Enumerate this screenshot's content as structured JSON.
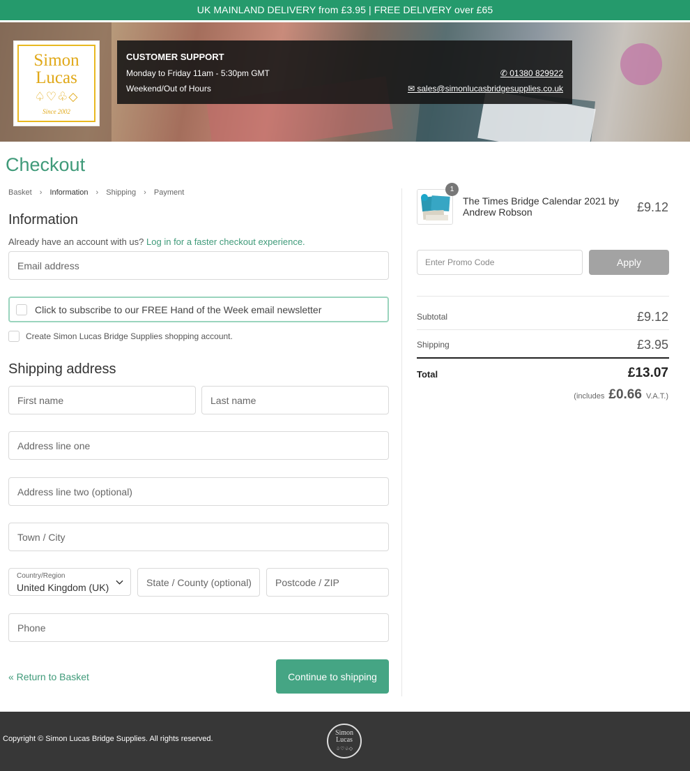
{
  "topbar": {
    "text": "UK MAINLAND DELIVERY from £3.95 | FREE DELIVERY over £65"
  },
  "logo": {
    "line1": "Simon",
    "line2": "Lucas",
    "suits": "♤♡♧◇",
    "since": "Since 2002"
  },
  "support": {
    "title": "CUSTOMER SUPPORT",
    "hours": "Monday to Friday 11am - 5:30pm GMT",
    "weekend": "Weekend/Out of Hours",
    "phone": "01380 829922",
    "email": "sales@simonlucasbridgesupplies.co.uk"
  },
  "page": {
    "title": "Checkout"
  },
  "breadcrumb": [
    "Basket",
    "Information",
    "Shipping",
    "Payment"
  ],
  "information": {
    "heading": "Information",
    "account_prompt": "Already have an account with us?",
    "login_link": "Log in for a faster checkout experience.",
    "email_placeholder": "Email address",
    "newsletter_label": "Click to subscribe to our FREE Hand of the Week email newsletter",
    "create_account_label": "Create Simon Lucas Bridge Supplies shopping account."
  },
  "shipping": {
    "heading": "Shipping address",
    "first_name": "First name",
    "last_name": "Last name",
    "address1": "Address line one",
    "address2": "Address line two (optional)",
    "city": "Town / City",
    "country_label": "Country/Region",
    "country_value": "United Kingdom (UK)",
    "state": "State / County (optional)",
    "postcode": "Postcode / ZIP",
    "phone": "Phone"
  },
  "actions": {
    "return": "« Return to Basket",
    "continue": "Continue to shipping"
  },
  "cart": {
    "item": {
      "name": "The Times Bridge Calendar 2021 by Andrew Robson",
      "price": "£9.12",
      "quantity": "1"
    },
    "promo_placeholder": "Enter Promo Code",
    "apply": "Apply",
    "subtotal_label": "Subtotal",
    "subtotal": "£9.12",
    "shipping_label": "Shipping",
    "shipping": "£3.95",
    "total_label": "Total",
    "total": "£13.07",
    "vat_prefix": "(includes",
    "vat_amount": "£0.66",
    "vat_suffix": "V.A.T.)"
  },
  "footer": {
    "copyright": "Copyright © Simon Lucas Bridge Supplies. All rights reserved.",
    "logo_line1": "Simon",
    "logo_line2": "Lucas"
  },
  "colors": {
    "brand_green": "#259a6c",
    "link_green": "#3f9a79",
    "button_green": "#45a584",
    "footer": "#373737"
  }
}
